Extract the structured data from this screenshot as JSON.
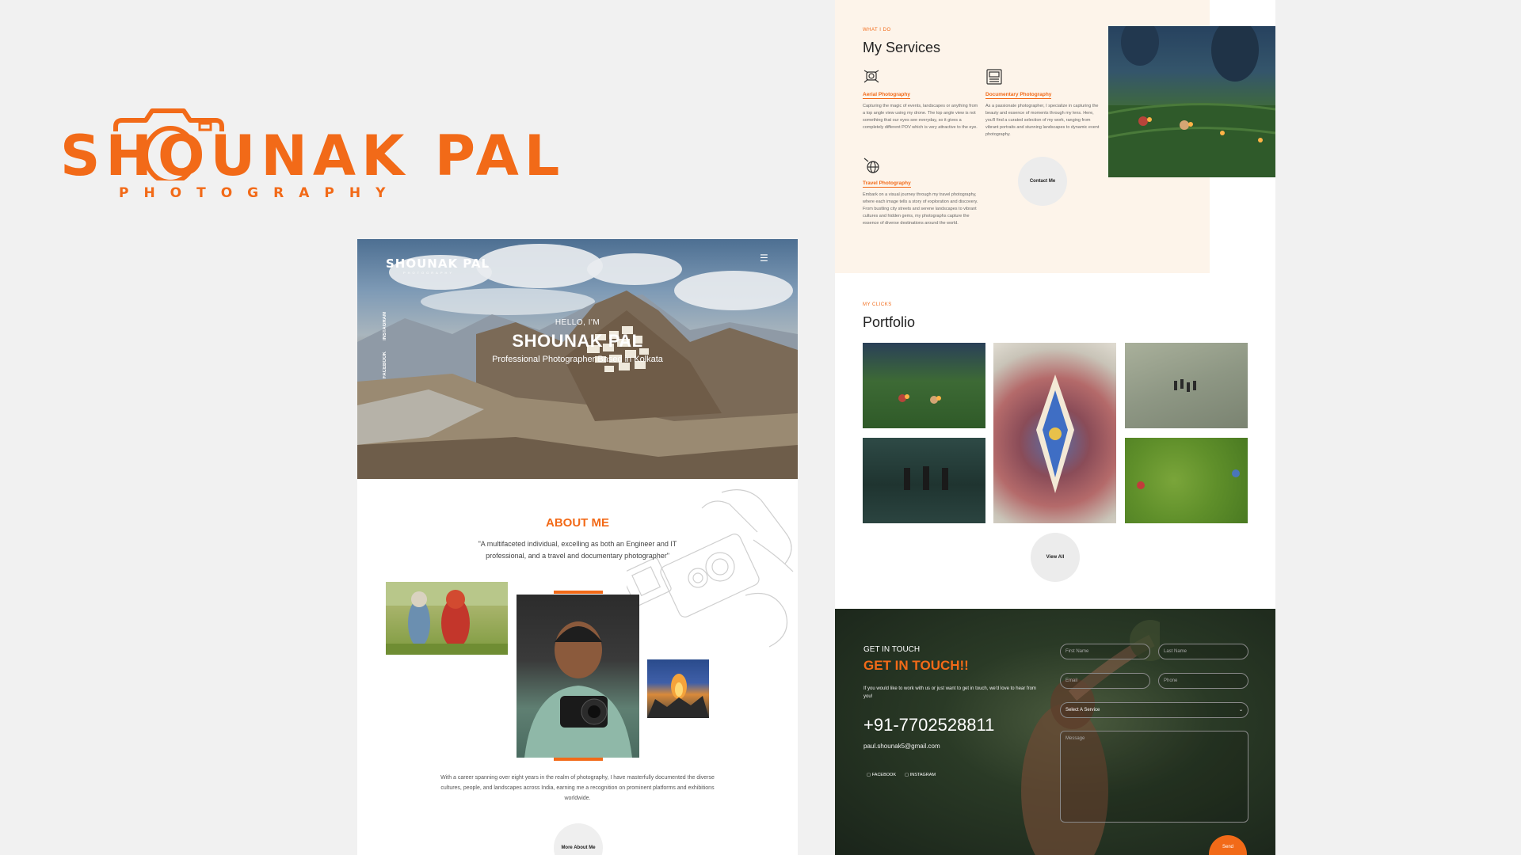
{
  "brand": {
    "name": "SHOUNAK PAL",
    "tagline": "PHOTOGRAPHY",
    "accent_color": "#f26a18"
  },
  "hero": {
    "logo_name": "SHOUNAK PAL",
    "logo_tagline": "PHOTOGRAPHY",
    "menu_icon": "hamburger-icon",
    "social": [
      "INSTAGRAM",
      "FACEBOOK"
    ],
    "hello": "HELLO, I'M",
    "name": "SHOUNAK PAL",
    "subtitle": "Professional Photographer Based in Kolkata"
  },
  "about": {
    "title": "ABOUT ME",
    "quote": "\"A multifaceted individual, excelling as both an Engineer and IT professional, and a travel and documentary photographer\"",
    "body": "With a career spanning over eight years in the realm of photography, I have masterfully documented the diverse cultures, people, and landscapes across India, earning me a recognition on prominent platforms and exhibitions worldwide.",
    "button": "More About Me"
  },
  "services": {
    "eyebrow": "WHAT I DO",
    "title": "My Services",
    "items": [
      {
        "icon": "drone-icon",
        "name": "Aerial Photography",
        "description": "Capturing the magic of events, landscapes or anything from a top angle view using my drone. The top angle view is not something that our eyes see everyday, so it gives a completely different POV which is very attractive to the eye."
      },
      {
        "icon": "newspaper-icon",
        "name": "Documentary Photography",
        "description": "As a passionate photographer, I specialize in capturing the beauty and essence of moments through my lens. Here, you'll find a curated selection of my work, ranging from vibrant portraits and stunning landscapes to dynamic event photography."
      },
      {
        "icon": "globe-icon",
        "name": "Travel Photography",
        "description": "Embark on a visual journey through my travel photography, where each image tells a story of exploration and discovery. From bustling city streets and serene landscapes to vibrant cultures and hidden gems, my photographs capture the essence of diverse destinations around the world."
      }
    ],
    "button": "Contact Me"
  },
  "portfolio": {
    "eyebrow": "MY CLICKS",
    "title": "Portfolio",
    "button": "View All"
  },
  "contact": {
    "eyebrow": "GET IN TOUCH",
    "title": "GET IN TOUCH!!",
    "intro": "If you would like to work with us or just want to get in touch, we'd love to hear from you!",
    "phone": "+91-7702528811",
    "email": "paul.shounak5@gmail.com",
    "social": [
      "FACEBOOK",
      "INSTAGRAM"
    ],
    "fields": {
      "first_name": "First Name",
      "last_name": "Last Name",
      "email": "Email",
      "phone": "Phone",
      "service": "Select A Service",
      "message": "Message"
    },
    "send": "Send"
  }
}
